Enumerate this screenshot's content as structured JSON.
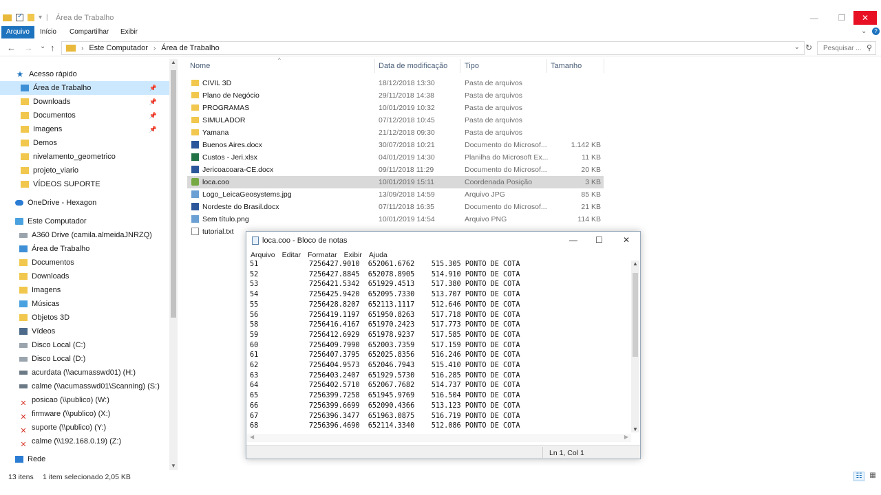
{
  "window": {
    "title": "Área de Trabalho",
    "minimize_glyph": "—",
    "restore_glyph": "❐",
    "close_glyph": "✕"
  },
  "ribbon": {
    "tabs": [
      "Arquivo",
      "Início",
      "Compartilhar",
      "Exibir"
    ],
    "expand_glyph": "⌄",
    "help_glyph": "?"
  },
  "address": {
    "back": "←",
    "forward": "→",
    "recent": "⌄",
    "up": "↑",
    "crumbs": [
      "Este Computador",
      "Área de Trabalho"
    ],
    "crumb_sep": "›",
    "dropdown": "⌄",
    "refresh": "↻",
    "search_placeholder": "Pesquisar ...",
    "search_icon_glyph": "⚲"
  },
  "nav": {
    "quick_access": "Acesso rápido",
    "quick_items": [
      {
        "label": "Área de Trabalho",
        "icon": "folder-blue-icon",
        "pinned": true
      },
      {
        "label": "Downloads",
        "icon": "folder-icon",
        "pinned": true
      },
      {
        "label": "Documentos",
        "icon": "folder-icon",
        "pinned": true
      },
      {
        "label": "Imagens",
        "icon": "folder-icon",
        "pinned": true
      },
      {
        "label": "Demos",
        "icon": "folder-icon",
        "pinned": false
      },
      {
        "label": "nivelamento_geometrico",
        "icon": "folder-icon",
        "pinned": false
      },
      {
        "label": "projeto_viario",
        "icon": "folder-icon",
        "pinned": false
      },
      {
        "label": "VÍDEOS SUPORTE",
        "icon": "folder-icon",
        "pinned": false
      }
    ],
    "onedrive": "OneDrive - Hexagon",
    "this_pc": "Este Computador",
    "pc_items": [
      {
        "label": "A360 Drive (camila.almeidaJNRZQ)",
        "icon": "drive-icon"
      },
      {
        "label": "Área de Trabalho",
        "icon": "folder-blue-icon"
      },
      {
        "label": "Documentos",
        "icon": "folder-icon"
      },
      {
        "label": "Downloads",
        "icon": "folder-icon"
      },
      {
        "label": "Imagens",
        "icon": "folder-icon"
      },
      {
        "label": "Músicas",
        "icon": "music-icon"
      },
      {
        "label": "Objetos 3D",
        "icon": "folder-icon"
      },
      {
        "label": "Vídeos",
        "icon": "video-icon"
      },
      {
        "label": "Disco Local (C:)",
        "icon": "drive-icon"
      },
      {
        "label": "Disco Local (D:)",
        "icon": "drive-icon"
      },
      {
        "label": "acurdata (\\\\acumasswd01) (H:)",
        "icon": "network-drive-icon"
      },
      {
        "label": "calme (\\\\acumasswd01\\Scanning) (S:)",
        "icon": "network-drive-icon"
      },
      {
        "label": "posicao (\\\\publico) (W:)",
        "icon": "disconnected-drive-icon"
      },
      {
        "label": "firmware (\\\\publico) (X:)",
        "icon": "disconnected-drive-icon"
      },
      {
        "label": "suporte (\\\\publico) (Y:)",
        "icon": "disconnected-drive-icon"
      },
      {
        "label": "calme (\\\\192.168.0.19) (Z:)",
        "icon": "disconnected-drive-icon"
      }
    ],
    "network": "Rede",
    "pin_glyph": "📌",
    "expand_glyph": "›"
  },
  "columns": {
    "name": "Nome",
    "modified": "Data de modificação",
    "type": "Tipo",
    "size": "Tamanho",
    "sort_glyph": "^"
  },
  "files": [
    {
      "name": "CIVIL 3D",
      "date": "18/12/2018 13:30",
      "type": "Pasta de arquivos",
      "size": "",
      "icon": "folder"
    },
    {
      "name": "Plano de Negócio",
      "date": "29/11/2018 14:38",
      "type": "Pasta de arquivos",
      "size": "",
      "icon": "folder"
    },
    {
      "name": "PROGRAMAS",
      "date": "10/01/2019 10:32",
      "type": "Pasta de arquivos",
      "size": "",
      "icon": "folder"
    },
    {
      "name": "SIMULADOR",
      "date": "07/12/2018 10:45",
      "type": "Pasta de arquivos",
      "size": "",
      "icon": "folder"
    },
    {
      "name": "Yamana",
      "date": "21/12/2018 09:30",
      "type": "Pasta de arquivos",
      "size": "",
      "icon": "folder"
    },
    {
      "name": "Buenos Aires.docx",
      "date": "30/07/2018 10:21",
      "type": "Documento do Microsof...",
      "size": "1.142 KB",
      "icon": "word"
    },
    {
      "name": "Custos - Jeri.xlsx",
      "date": "04/01/2019 14:30",
      "type": "Planilha do Microsoft Ex...",
      "size": "11 KB",
      "icon": "excel"
    },
    {
      "name": "Jericoacoara-CE.docx",
      "date": "09/11/2018 11:29",
      "type": "Documento do Microsof...",
      "size": "20 KB",
      "icon": "word"
    },
    {
      "name": "loca.coo",
      "date": "10/01/2019 15:11",
      "type": "Coordenada Posição",
      "size": "3 KB",
      "icon": "coo",
      "selected": true
    },
    {
      "name": "Logo_LeicaGeosystems.jpg",
      "date": "13/09/2018 14:59",
      "type": "Arquivo JPG",
      "size": "85 KB",
      "icon": "img"
    },
    {
      "name": "Nordeste do Brasil.docx",
      "date": "07/11/2018 16:35",
      "type": "Documento do Microsof...",
      "size": "21 KB",
      "icon": "word"
    },
    {
      "name": "Sem título.png",
      "date": "10/01/2019 14:54",
      "type": "Arquivo PNG",
      "size": "114 KB",
      "icon": "img"
    },
    {
      "name": "tutorial.txt",
      "date": "",
      "type": "",
      "size": "",
      "icon": "txt"
    }
  ],
  "notepad": {
    "title": "loca.coo - Bloco de notas",
    "minimize_glyph": "—",
    "maximize_glyph": "☐",
    "close_glyph": "✕",
    "menu": [
      "Arquivo",
      "Editar",
      "Formatar",
      "Exibir",
      "Ajuda"
    ],
    "lines": [
      "51            7256427.9010  652061.6762    515.305 PONTO DE COTA",
      "52            7256427.8845  652078.8905    514.910 PONTO DE COTA",
      "53            7256421.5342  651929.4513    517.380 PONTO DE COTA",
      "54            7256425.9420  652095.7330    513.707 PONTO DE COTA",
      "55            7256428.8207  652113.1117    512.646 PONTO DE COTA",
      "56            7256419.1197  651950.8263    517.718 PONTO DE COTA",
      "58            7256416.4167  651970.2423    517.773 PONTO DE COTA",
      "59            7256412.6929  651978.9237    517.585 PONTO DE COTA",
      "60            7256409.7990  652003.7359    517.159 PONTO DE COTA",
      "61            7256407.3795  652025.8356    516.246 PONTO DE COTA",
      "62            7256404.9573  652046.7943    515.410 PONTO DE COTA",
      "63            7256403.2407  651929.5730    516.285 PONTO DE COTA",
      "64            7256402.5710  652067.7682    514.737 PONTO DE COTA",
      "65            7256399.7258  651945.9769    516.504 PONTO DE COTA",
      "66            7256399.6699  652090.4366    513.123 PONTO DE COTA",
      "67            7256396.3477  651963.0875    516.719 PONTO DE COTA",
      "68            7256396.4690  652114.3340    512.086 PONTO DE COTA"
    ],
    "status": "Ln 1, Col 1",
    "scroll_up": "▲",
    "scroll_down": "▼",
    "scroll_left": "◀",
    "scroll_right": "▶"
  },
  "status": {
    "count": "13 itens",
    "selection": "1 item selecionado  2,05 KB",
    "details_view_glyph": "☷",
    "icons_view_glyph": "▦"
  }
}
